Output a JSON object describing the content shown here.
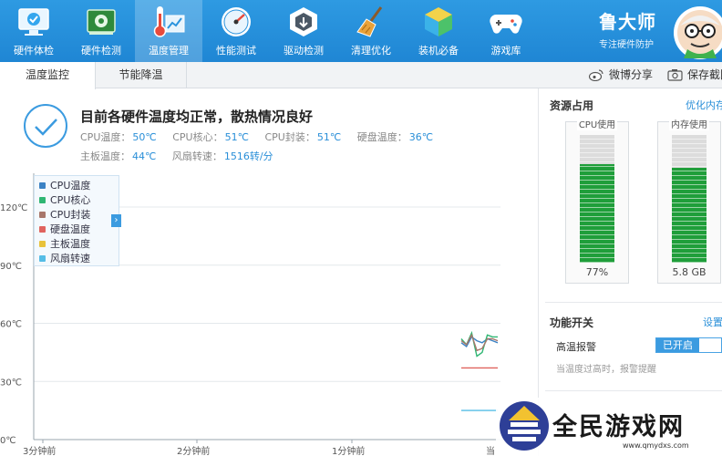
{
  "toolbar": {
    "items": [
      {
        "label": "硬件体检",
        "icon": "monitor-check-icon"
      },
      {
        "label": "硬件检测",
        "icon": "circuit-board-icon"
      },
      {
        "label": "温度管理",
        "icon": "thermometer-chart-icon",
        "active": true
      },
      {
        "label": "性能测试",
        "icon": "speedometer-icon"
      },
      {
        "label": "驱动检测",
        "icon": "driver-chip-icon"
      },
      {
        "label": "清理优化",
        "icon": "broom-icon"
      },
      {
        "label": "装机必备",
        "icon": "cube-box-icon"
      },
      {
        "label": "游戏库",
        "icon": "gamepad-icon"
      }
    ],
    "brand_name": "鲁大师",
    "brand_sub": "专注硬件防护"
  },
  "tabs": {
    "items": [
      {
        "label": "温度监控",
        "active": true
      },
      {
        "label": "节能降温",
        "active": false
      }
    ],
    "weibo_share": "微博分享",
    "save_screenshot": "保存截图"
  },
  "status": {
    "title": "目前各硬件温度均正常，散热情况良好",
    "row1": [
      {
        "key": "CPU温度：",
        "value": "50℃"
      },
      {
        "key": "CPU核心：",
        "value": "51℃"
      },
      {
        "key": "CPU封装：",
        "value": "51℃"
      },
      {
        "key": "硬盘温度：",
        "value": "36℃"
      }
    ],
    "row2": [
      {
        "key": "主板温度：",
        "value": "44℃"
      },
      {
        "key": "风扇转速：",
        "value": "1516转/分"
      }
    ]
  },
  "chart_data": {
    "type": "line",
    "y_ticks": [
      "120℃",
      "90℃",
      "60℃",
      "30℃",
      "0℃"
    ],
    "ylim": [
      0,
      120
    ],
    "x_ticks": [
      "3分钟前",
      "2分钟前",
      "1分钟前",
      "当"
    ],
    "legend": [
      {
        "name": "CPU温度",
        "color": "#3b82c4"
      },
      {
        "name": "CPU核心",
        "color": "#2fb673"
      },
      {
        "name": "CPU封装",
        "color": "#a7766a"
      },
      {
        "name": "硬盘温度",
        "color": "#e0635e"
      },
      {
        "name": "主板温度",
        "color": "#e8c23a"
      },
      {
        "name": "风扇转速",
        "color": "#55bde6"
      }
    ],
    "series": [
      {
        "name": "CPU温度",
        "color": "#3b82c4",
        "values": [
          50,
          48,
          53,
          51,
          50,
          52,
          51,
          50
        ]
      },
      {
        "name": "CPU核心",
        "color": "#2fb673",
        "values": [
          52,
          49,
          55,
          43,
          45,
          54,
          53,
          53
        ]
      },
      {
        "name": "CPU封装",
        "color": "#a7766a",
        "values": [
          51,
          49,
          54,
          46,
          47,
          52,
          52,
          51
        ]
      },
      {
        "name": "硬盘温度",
        "color": "#e0635e",
        "values": [
          37,
          37,
          37,
          37,
          37,
          37,
          37,
          37
        ]
      },
      {
        "name": "风扇转速",
        "color": "#55bde6",
        "values": [
          15,
          15,
          15,
          15,
          15,
          15,
          15,
          15
        ]
      }
    ]
  },
  "resources": {
    "title": "资源占用",
    "optimize_link": "优化内存",
    "cpu": {
      "label": "CPU使用",
      "value_text": "77%",
      "fraction": 0.77
    },
    "memory": {
      "label": "内存使用",
      "value_text": "5.8 GB",
      "fraction": 0.74
    }
  },
  "functions": {
    "title": "功能开关",
    "settings_link": "设置",
    "high_temp_alarm_label": "高温报警",
    "toggle_on_label": "已开启",
    "hint": "当温度过高时，报警提醒"
  },
  "watermark": {
    "text": "全民游戏网",
    "url": "www.qmydxs.com"
  },
  "colors": {
    "toolbar_blue": "#2a93dd",
    "accent": "#2a8fd8",
    "meter_green": "#1f9e3a"
  }
}
